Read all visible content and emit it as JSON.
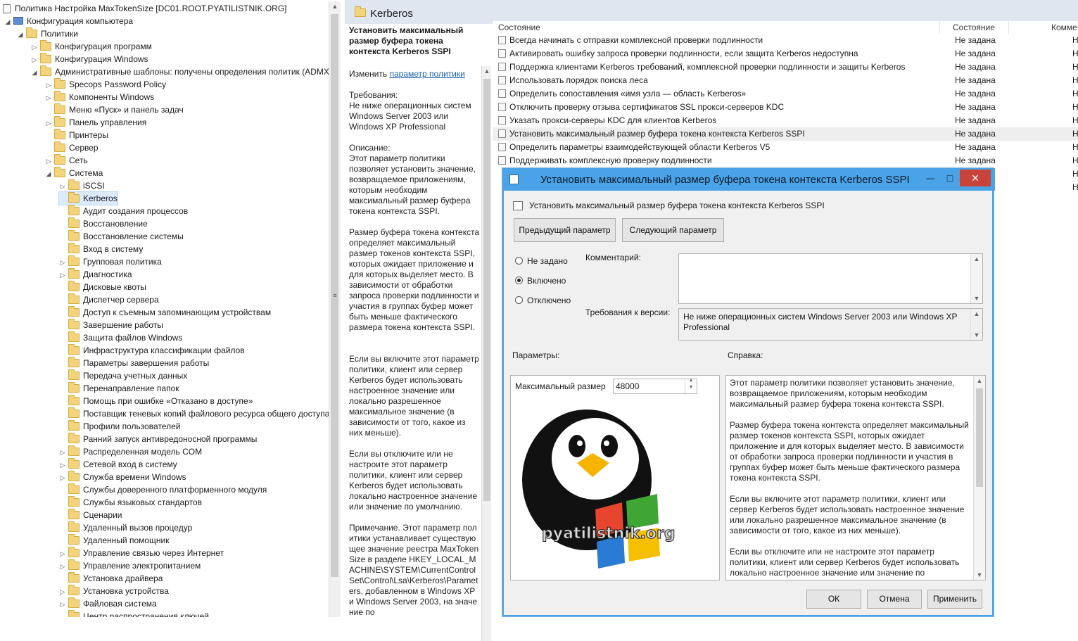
{
  "tree": {
    "root_title": "Политика Настройка MaxTokenSize [DC01.ROOT.PYATILISTNIK.ORG]",
    "items": [
      {
        "label": "Конфигурация компьютера",
        "level": 1,
        "exp": "◢"
      },
      {
        "label": "Политики",
        "level": 2,
        "exp": "◢"
      },
      {
        "label": "Конфигурация программ",
        "level": 3,
        "exp": "▷"
      },
      {
        "label": "Конфигурация Windows",
        "level": 3,
        "exp": "▷"
      },
      {
        "label": "Административные шаблоны: получены определения политик (ADMX",
        "level": 3,
        "exp": "◢"
      },
      {
        "label": "Specops Password Policy",
        "level": 4,
        "exp": "▷"
      },
      {
        "label": "Компоненты Windows",
        "level": 4,
        "exp": "▷"
      },
      {
        "label": "Меню «Пуск» и панель задач",
        "level": 4,
        "exp": ""
      },
      {
        "label": "Панель управления",
        "level": 4,
        "exp": "▷"
      },
      {
        "label": "Принтеры",
        "level": 4,
        "exp": ""
      },
      {
        "label": "Сервер",
        "level": 4,
        "exp": ""
      },
      {
        "label": "Сеть",
        "level": 4,
        "exp": "▷"
      },
      {
        "label": "Система",
        "level": 4,
        "exp": "◢"
      },
      {
        "label": "iSCSI",
        "level": 5,
        "exp": "▷"
      },
      {
        "label": "Kerberos",
        "level": 5,
        "exp": "",
        "selected": true
      },
      {
        "label": "Аудит создания процессов",
        "level": 5,
        "exp": ""
      },
      {
        "label": "Восстановление",
        "level": 5,
        "exp": ""
      },
      {
        "label": "Восстановление системы",
        "level": 5,
        "exp": ""
      },
      {
        "label": "Вход в систему",
        "level": 5,
        "exp": ""
      },
      {
        "label": "Групповая политика",
        "level": 5,
        "exp": "▷"
      },
      {
        "label": "Диагностика",
        "level": 5,
        "exp": "▷"
      },
      {
        "label": "Дисковые квоты",
        "level": 5,
        "exp": ""
      },
      {
        "label": "Диспетчер сервера",
        "level": 5,
        "exp": ""
      },
      {
        "label": "Доступ к съемным запоминающим устройствам",
        "level": 5,
        "exp": ""
      },
      {
        "label": "Завершение работы",
        "level": 5,
        "exp": ""
      },
      {
        "label": "Защита файлов Windows",
        "level": 5,
        "exp": ""
      },
      {
        "label": "Инфраструктура классификации файлов",
        "level": 5,
        "exp": ""
      },
      {
        "label": "Параметры завершения работы",
        "level": 5,
        "exp": ""
      },
      {
        "label": "Передача учетных данных",
        "level": 5,
        "exp": ""
      },
      {
        "label": "Перенаправление папок",
        "level": 5,
        "exp": ""
      },
      {
        "label": "Помощь при ошибке «Отказано в доступе»",
        "level": 5,
        "exp": ""
      },
      {
        "label": "Поставщик теневых копий файлового ресурса общего доступа",
        "level": 5,
        "exp": ""
      },
      {
        "label": "Профили пользователей",
        "level": 5,
        "exp": ""
      },
      {
        "label": "Ранний запуск антивредоносной программы",
        "level": 5,
        "exp": ""
      },
      {
        "label": "Распределенная модель COM",
        "level": 5,
        "exp": "▷"
      },
      {
        "label": "Сетевой вход в систему",
        "level": 5,
        "exp": "▷"
      },
      {
        "label": "Служба времени Windows",
        "level": 5,
        "exp": "▷"
      },
      {
        "label": "Службы доверенного платформенного модуля",
        "level": 5,
        "exp": ""
      },
      {
        "label": "Службы языковых стандартов",
        "level": 5,
        "exp": ""
      },
      {
        "label": "Сценарии",
        "level": 5,
        "exp": ""
      },
      {
        "label": "Удаленный вызов процедур",
        "level": 5,
        "exp": ""
      },
      {
        "label": "Удаленный помощник",
        "level": 5,
        "exp": ""
      },
      {
        "label": "Управление связью через Интернет",
        "level": 5,
        "exp": "▷"
      },
      {
        "label": "Управление электропитанием",
        "level": 5,
        "exp": "▷"
      },
      {
        "label": "Установка драйвера",
        "level": 5,
        "exp": ""
      },
      {
        "label": "Установка устройства",
        "level": 5,
        "exp": "▷"
      },
      {
        "label": "Файловая система",
        "level": 5,
        "exp": "▷"
      },
      {
        "label": "Центр распространения ключей",
        "level": 5,
        "exp": ""
      }
    ]
  },
  "middle": {
    "header_title": "Kerberos",
    "policy_title": "Установить максимальный размер буфера токена контекста Kerberos SSPI",
    "edit_prefix": "Изменить",
    "edit_link": "параметр политики",
    "requirements_label": "Требования:",
    "requirements_text": "Не ниже операционных систем Windows Server 2003 или Windows XP Professional",
    "description_label": "Описание:",
    "description_1": "Этот параметр политики позволяет установить значение, возвращаемое приложениям, которым необходим максимальный размер буфера токена контекста SSPI.",
    "description_2": "Размер буфера токена контекста определяет максимальный размер токенов контекста SSPI, которых ожидает приложение и для которых выделяет место. В зависимости от обработки запроса проверки подлинности и участия в группах буфер может быть меньше фактического размера токена контекста SSPI.",
    "description_3": "Если вы включите этот параметр политики, клиент или сервер Kerberos будет использовать настроенное значение или локально разрешенное максимальное значение (в зависимости от того, какое из них меньше).",
    "description_4": "Если вы отключите или не настроите этот параметр политики, клиент или сервер Kerberos будет использовать локально настроенное значение или значение по умолчанию.",
    "description_5": "Примечание. Этот параметр политики устанавливает существующее значение реестра MaxTokenSize в разделе HKEY_LOCAL_MACHINE\\SYSTEM\\CurrentControlSet\\Control\\Lsa\\Kerberos\\Parameters, добавленном в Windows XP и Windows Server 2003, на значение по"
  },
  "list": {
    "columns": [
      "Состояние",
      "Состояние",
      "Комме"
    ],
    "rows": [
      {
        "name": "Всегда начинать с отправки комплексной проверки подлинности",
        "state": "Не задана",
        "c": "Н"
      },
      {
        "name": "Активировать ошибку запроса проверки подлинности, если защита Kerberos недоступна",
        "state": "Не задана",
        "c": "Н"
      },
      {
        "name": "Поддержка клиентами Kerberos требований, комплексной проверки подлинности и защиты Kerberos",
        "state": "Не задана",
        "c": "Н"
      },
      {
        "name": "Использовать порядок поиска леса",
        "state": "Не задана",
        "c": "Н"
      },
      {
        "name": "Определить сопоставления «имя узла — область Kerberos»",
        "state": "Не задана",
        "c": "Н"
      },
      {
        "name": "Отключить проверку отзыва сертификатов SSL прокси-серверов KDC",
        "state": "Не задана",
        "c": "Н"
      },
      {
        "name": "Указать прокси-серверы KDC для клиентов Kerberos",
        "state": "Не задана",
        "c": "Н"
      },
      {
        "name": "Установить максимальный размер буфера токена контекста Kerberos SSPI",
        "state": "Не задана",
        "c": "Н",
        "selected": true
      },
      {
        "name": "Определить параметры взаимодействующей области Kerberos V5",
        "state": "Не задана",
        "c": "Н"
      },
      {
        "name": "Поддерживать комплексную проверку подлинности",
        "state": "Не задана",
        "c": "Н"
      },
      {
        "name": "",
        "state": "",
        "c": "Н"
      },
      {
        "name": "",
        "state": "",
        "c": "Н"
      }
    ]
  },
  "dialog": {
    "title": "Установить максимальный размер буфера токена контекста Kerberos SSPI",
    "subtitle": "Установить максимальный размер буфера токена контекста Kerberos SSPI",
    "prev_button": "Предыдущий параметр",
    "next_button": "Следующий параметр",
    "radio_not_set": "Не задано",
    "radio_enabled": "Включено",
    "radio_disabled": "Отключено",
    "comment_label": "Комментарий:",
    "comment_value": "",
    "version_label": "Требования к версии:",
    "version_text": "Не ниже операционных систем Windows Server 2003 или Windows XP Professional",
    "params_label": "Параметры:",
    "help_label": "Справка:",
    "max_size_label": "Максимальный размер",
    "max_size_value": "48000",
    "watermark_text": "pyatilistnik.org",
    "help_1": "Этот параметр политики позволяет установить значение, возвращаемое приложениям, которым необходим максимальный размер буфера токена контекста SSPI.",
    "help_2": "Размер буфера токена контекста определяет максимальный размер токенов контекста SSPI, которых ожидает приложение и для которых выделяет место. В зависимости от обработки запроса проверки подлинности и участия в группах буфер может быть меньше фактического размера токена контекста SSPI.",
    "help_3": "Если вы включите этот параметр политики, клиент или сервер Kerberos будет использовать настроенное значение или локально разрешенное максимальное значение (в зависимости от того, какое из них меньше).",
    "help_4": "Если вы отключите или не настроите этот параметр политики, клиент или сервер Kerberos будет использовать локально настроенное значение или значение по",
    "ok_button": "ОК",
    "cancel_button": "Отмена",
    "apply_button": "Применить",
    "minimize_glyph": "—",
    "maximize_glyph": "□",
    "close_glyph": "✕"
  },
  "colors": {
    "dialog_title_bg": "#4aa3e6",
    "selection_bg": "#dcebfc",
    "link": "#1a5fb4"
  }
}
